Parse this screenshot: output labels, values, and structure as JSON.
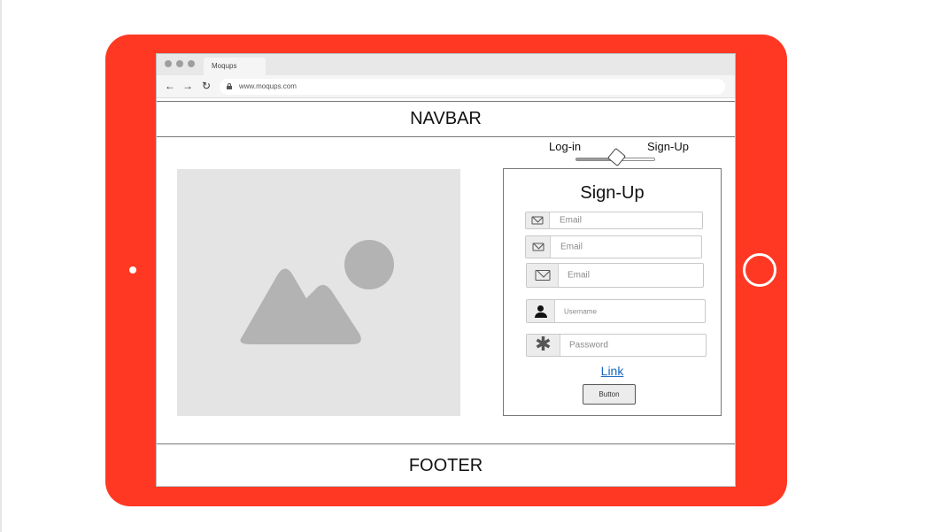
{
  "colors": {
    "tablet": "#ff3824",
    "link": "#1565c0",
    "placeholder": "#e4e4e4"
  },
  "browser": {
    "tab_title": "Moqups",
    "url": "www.moqups.com",
    "controls": {
      "back": "←",
      "forward": "→",
      "reload": "↻"
    }
  },
  "navbar": {
    "label": "NAVBAR"
  },
  "toggle": {
    "left_label": "Log-in",
    "right_label": "Sign-Up"
  },
  "image": {
    "icon": "image-placeholder-icon"
  },
  "signup": {
    "title": "Sign-Up",
    "fields": [
      {
        "icon": "mail-icon",
        "placeholder": "Email"
      },
      {
        "icon": "mail-icon",
        "placeholder": "Email"
      },
      {
        "icon": "mail-icon",
        "placeholder": "Email"
      },
      {
        "icon": "user-icon",
        "placeholder": "Username"
      },
      {
        "icon": "asterisk-icon",
        "placeholder": "Password"
      }
    ],
    "link_label": "Link",
    "button_label": "Button"
  },
  "footer": {
    "label": "FOOTER"
  }
}
